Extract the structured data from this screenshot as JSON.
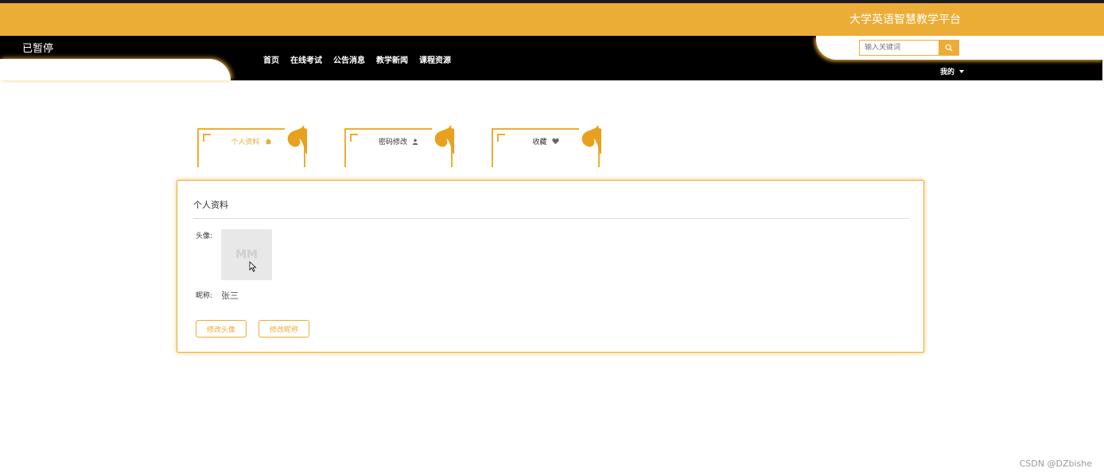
{
  "header": {
    "site_title": "大学英语智慧教学平台",
    "status": "已暂停",
    "search_placeholder": "输入关键词",
    "mine_label": "我的"
  },
  "nav": {
    "items": [
      {
        "label": "首页"
      },
      {
        "label": "在线考试"
      },
      {
        "label": "公告消息"
      },
      {
        "label": "教学新闻"
      },
      {
        "label": "课程资源"
      }
    ]
  },
  "tabs": [
    {
      "label": "个人资料",
      "icon": "home-icon",
      "active": true
    },
    {
      "label": "密码修改",
      "icon": "user-icon",
      "active": false
    },
    {
      "label": "收藏",
      "icon": "heart-icon",
      "active": false
    }
  ],
  "profile": {
    "title": "个人资料",
    "avatar_label": "头像:",
    "avatar_placeholder": "MM",
    "nickname_label": "昵称:",
    "nickname": "张三",
    "change_avatar_button": "修改头像",
    "change_nickname_button": "修改昵称"
  },
  "watermark": "CSDN @DZbishe",
  "colors": {
    "accent": "#ecad36",
    "header_black": "#000000"
  }
}
